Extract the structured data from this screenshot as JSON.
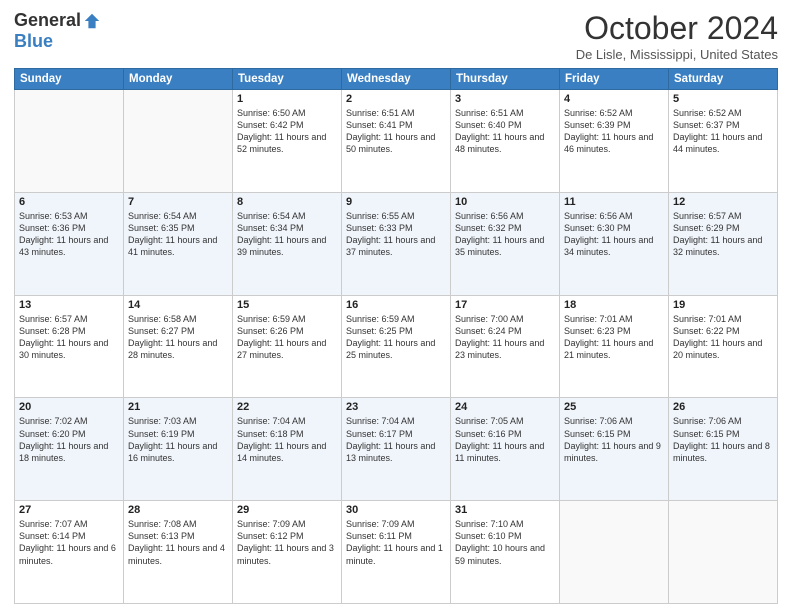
{
  "header": {
    "logo_general": "General",
    "logo_blue": "Blue",
    "title": "October 2024",
    "location": "De Lisle, Mississippi, United States"
  },
  "days_of_week": [
    "Sunday",
    "Monday",
    "Tuesday",
    "Wednesday",
    "Thursday",
    "Friday",
    "Saturday"
  ],
  "weeks": [
    [
      {
        "day": "",
        "info": ""
      },
      {
        "day": "",
        "info": ""
      },
      {
        "day": "1",
        "info": "Sunrise: 6:50 AM\nSunset: 6:42 PM\nDaylight: 11 hours and 52 minutes."
      },
      {
        "day": "2",
        "info": "Sunrise: 6:51 AM\nSunset: 6:41 PM\nDaylight: 11 hours and 50 minutes."
      },
      {
        "day": "3",
        "info": "Sunrise: 6:51 AM\nSunset: 6:40 PM\nDaylight: 11 hours and 48 minutes."
      },
      {
        "day": "4",
        "info": "Sunrise: 6:52 AM\nSunset: 6:39 PM\nDaylight: 11 hours and 46 minutes."
      },
      {
        "day": "5",
        "info": "Sunrise: 6:52 AM\nSunset: 6:37 PM\nDaylight: 11 hours and 44 minutes."
      }
    ],
    [
      {
        "day": "6",
        "info": "Sunrise: 6:53 AM\nSunset: 6:36 PM\nDaylight: 11 hours and 43 minutes."
      },
      {
        "day": "7",
        "info": "Sunrise: 6:54 AM\nSunset: 6:35 PM\nDaylight: 11 hours and 41 minutes."
      },
      {
        "day": "8",
        "info": "Sunrise: 6:54 AM\nSunset: 6:34 PM\nDaylight: 11 hours and 39 minutes."
      },
      {
        "day": "9",
        "info": "Sunrise: 6:55 AM\nSunset: 6:33 PM\nDaylight: 11 hours and 37 minutes."
      },
      {
        "day": "10",
        "info": "Sunrise: 6:56 AM\nSunset: 6:32 PM\nDaylight: 11 hours and 35 minutes."
      },
      {
        "day": "11",
        "info": "Sunrise: 6:56 AM\nSunset: 6:30 PM\nDaylight: 11 hours and 34 minutes."
      },
      {
        "day": "12",
        "info": "Sunrise: 6:57 AM\nSunset: 6:29 PM\nDaylight: 11 hours and 32 minutes."
      }
    ],
    [
      {
        "day": "13",
        "info": "Sunrise: 6:57 AM\nSunset: 6:28 PM\nDaylight: 11 hours and 30 minutes."
      },
      {
        "day": "14",
        "info": "Sunrise: 6:58 AM\nSunset: 6:27 PM\nDaylight: 11 hours and 28 minutes."
      },
      {
        "day": "15",
        "info": "Sunrise: 6:59 AM\nSunset: 6:26 PM\nDaylight: 11 hours and 27 minutes."
      },
      {
        "day": "16",
        "info": "Sunrise: 6:59 AM\nSunset: 6:25 PM\nDaylight: 11 hours and 25 minutes."
      },
      {
        "day": "17",
        "info": "Sunrise: 7:00 AM\nSunset: 6:24 PM\nDaylight: 11 hours and 23 minutes."
      },
      {
        "day": "18",
        "info": "Sunrise: 7:01 AM\nSunset: 6:23 PM\nDaylight: 11 hours and 21 minutes."
      },
      {
        "day": "19",
        "info": "Sunrise: 7:01 AM\nSunset: 6:22 PM\nDaylight: 11 hours and 20 minutes."
      }
    ],
    [
      {
        "day": "20",
        "info": "Sunrise: 7:02 AM\nSunset: 6:20 PM\nDaylight: 11 hours and 18 minutes."
      },
      {
        "day": "21",
        "info": "Sunrise: 7:03 AM\nSunset: 6:19 PM\nDaylight: 11 hours and 16 minutes."
      },
      {
        "day": "22",
        "info": "Sunrise: 7:04 AM\nSunset: 6:18 PM\nDaylight: 11 hours and 14 minutes."
      },
      {
        "day": "23",
        "info": "Sunrise: 7:04 AM\nSunset: 6:17 PM\nDaylight: 11 hours and 13 minutes."
      },
      {
        "day": "24",
        "info": "Sunrise: 7:05 AM\nSunset: 6:16 PM\nDaylight: 11 hours and 11 minutes."
      },
      {
        "day": "25",
        "info": "Sunrise: 7:06 AM\nSunset: 6:15 PM\nDaylight: 11 hours and 9 minutes."
      },
      {
        "day": "26",
        "info": "Sunrise: 7:06 AM\nSunset: 6:15 PM\nDaylight: 11 hours and 8 minutes."
      }
    ],
    [
      {
        "day": "27",
        "info": "Sunrise: 7:07 AM\nSunset: 6:14 PM\nDaylight: 11 hours and 6 minutes."
      },
      {
        "day": "28",
        "info": "Sunrise: 7:08 AM\nSunset: 6:13 PM\nDaylight: 11 hours and 4 minutes."
      },
      {
        "day": "29",
        "info": "Sunrise: 7:09 AM\nSunset: 6:12 PM\nDaylight: 11 hours and 3 minutes."
      },
      {
        "day": "30",
        "info": "Sunrise: 7:09 AM\nSunset: 6:11 PM\nDaylight: 11 hours and 1 minute."
      },
      {
        "day": "31",
        "info": "Sunrise: 7:10 AM\nSunset: 6:10 PM\nDaylight: 10 hours and 59 minutes."
      },
      {
        "day": "",
        "info": ""
      },
      {
        "day": "",
        "info": ""
      }
    ]
  ]
}
